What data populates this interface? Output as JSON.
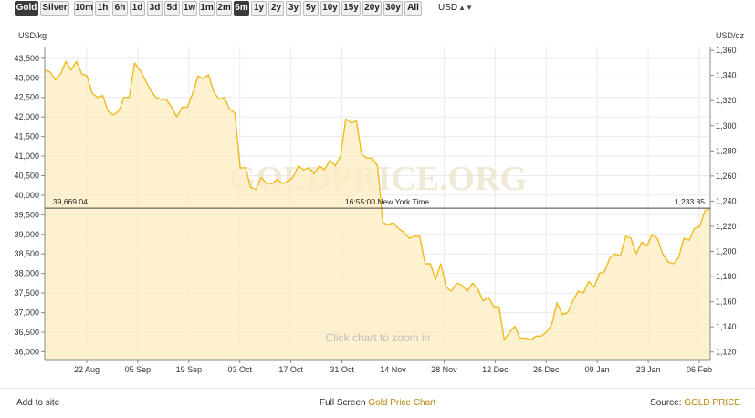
{
  "controls": {
    "buttons": [
      {
        "label": "Gold",
        "active": true
      },
      {
        "label": "Silver",
        "active": false
      },
      {
        "label": "10m",
        "active": false
      },
      {
        "label": "1h",
        "active": false
      },
      {
        "label": "6h",
        "active": false
      },
      {
        "label": "1d",
        "active": false
      },
      {
        "label": "3d",
        "active": false
      },
      {
        "label": "5d",
        "active": false
      },
      {
        "label": "1w",
        "active": false
      },
      {
        "label": "1m",
        "active": false
      },
      {
        "label": "2m",
        "active": false
      },
      {
        "label": "6m",
        "active": true
      },
      {
        "label": "1y",
        "active": false
      },
      {
        "label": "2y",
        "active": false
      },
      {
        "label": "3y",
        "active": false
      },
      {
        "label": "5y",
        "active": false
      },
      {
        "label": "10y",
        "active": false
      },
      {
        "label": "15y",
        "active": false
      },
      {
        "label": "20y",
        "active": false
      },
      {
        "label": "30y",
        "active": false
      },
      {
        "label": "All",
        "active": false
      }
    ],
    "currency": "USD"
  },
  "chart_data": {
    "type": "area",
    "left_axis_unit": "USD/kg",
    "right_axis_unit": "USD/oz",
    "ylim_left": [
      35800,
      43800
    ],
    "ylim_right": [
      1114,
      1363
    ],
    "left_ticks": [
      36000,
      36500,
      37000,
      37500,
      38000,
      38500,
      39000,
      39500,
      40000,
      40500,
      41000,
      41500,
      42000,
      42500,
      43000,
      43500
    ],
    "left_tick_labels": [
      "36,000",
      "36,500",
      "37,000",
      "37,500",
      "38,000",
      "38,500",
      "39,000",
      "39,500",
      "40,000",
      "40,500",
      "41,000",
      "41,500",
      "42,000",
      "42,500",
      "43,000",
      "43,500"
    ],
    "right_ticks": [
      1120,
      1140,
      1160,
      1180,
      1200,
      1220,
      1240,
      1260,
      1280,
      1300,
      1320,
      1340,
      1360
    ],
    "right_tick_labels": [
      "1,120",
      "1,140",
      "1,160",
      "1,180",
      "1,200",
      "1,220",
      "1,240",
      "1,260",
      "1,280",
      "1,300",
      "1,320",
      "1,340",
      "1,360"
    ],
    "x_tick_labels": [
      "22 Aug",
      "05 Sep",
      "19 Sep",
      "03 Oct",
      "17 Oct",
      "31 Oct",
      "14 Nov",
      "28 Nov",
      "12 Dec",
      "26 Dec",
      "09 Jan",
      "23 Jan",
      "06 Feb"
    ],
    "grid": true,
    "watermark": "GOLDPRICE.ORG",
    "hint": "Click chart to zoom in",
    "crosshair": {
      "left_value_label": "39,669.04",
      "time_label": "16:55:00 New York Time",
      "right_value_label": "1,233.85",
      "value_kg": 39669.04
    },
    "series": [
      {
        "values": [
          43200,
          43150,
          42950,
          43100,
          43420,
          43200,
          43420,
          43100,
          43050,
          42600,
          42500,
          42550,
          42150,
          42050,
          42150,
          42500,
          42500,
          43380,
          43200,
          42950,
          42700,
          42500,
          42450,
          42450,
          42250,
          42000,
          42250,
          42250,
          42600,
          43050,
          42980,
          43080,
          42650,
          42450,
          42500,
          42200,
          42100,
          40700,
          40700,
          40200,
          40150,
          40450,
          40300,
          40300,
          40400,
          40300,
          40350,
          40450,
          40750,
          40650,
          40700,
          40550,
          40750,
          40650,
          40900,
          40750,
          41000,
          41950,
          41850,
          41900,
          41050,
          40950,
          40950,
          40750,
          39300,
          39250,
          39300,
          39150,
          39050,
          38900,
          38950,
          38950,
          38250,
          38250,
          37850,
          38250,
          37650,
          37550,
          37750,
          37700,
          37550,
          37750,
          37600,
          37300,
          37400,
          37150,
          37150,
          36300,
          36500,
          36650,
          36350,
          36350,
          36300,
          36400,
          36400,
          36500,
          36700,
          37250,
          36950,
          37000,
          37300,
          37550,
          37500,
          37800,
          37650,
          38000,
          38050,
          38400,
          38500,
          38450,
          38950,
          38900,
          38500,
          38800,
          38700,
          39000,
          38900,
          38500,
          38300,
          38250,
          38400,
          38900,
          38850,
          39150,
          39200,
          39600,
          39669.04
        ]
      }
    ]
  },
  "footer": {
    "add_to_site": "Add to site",
    "full_screen_prefix": "Full Screen ",
    "full_screen_link": "Gold Price Chart",
    "source_prefix": "Source: ",
    "source_link": "GOLD PRICE"
  }
}
